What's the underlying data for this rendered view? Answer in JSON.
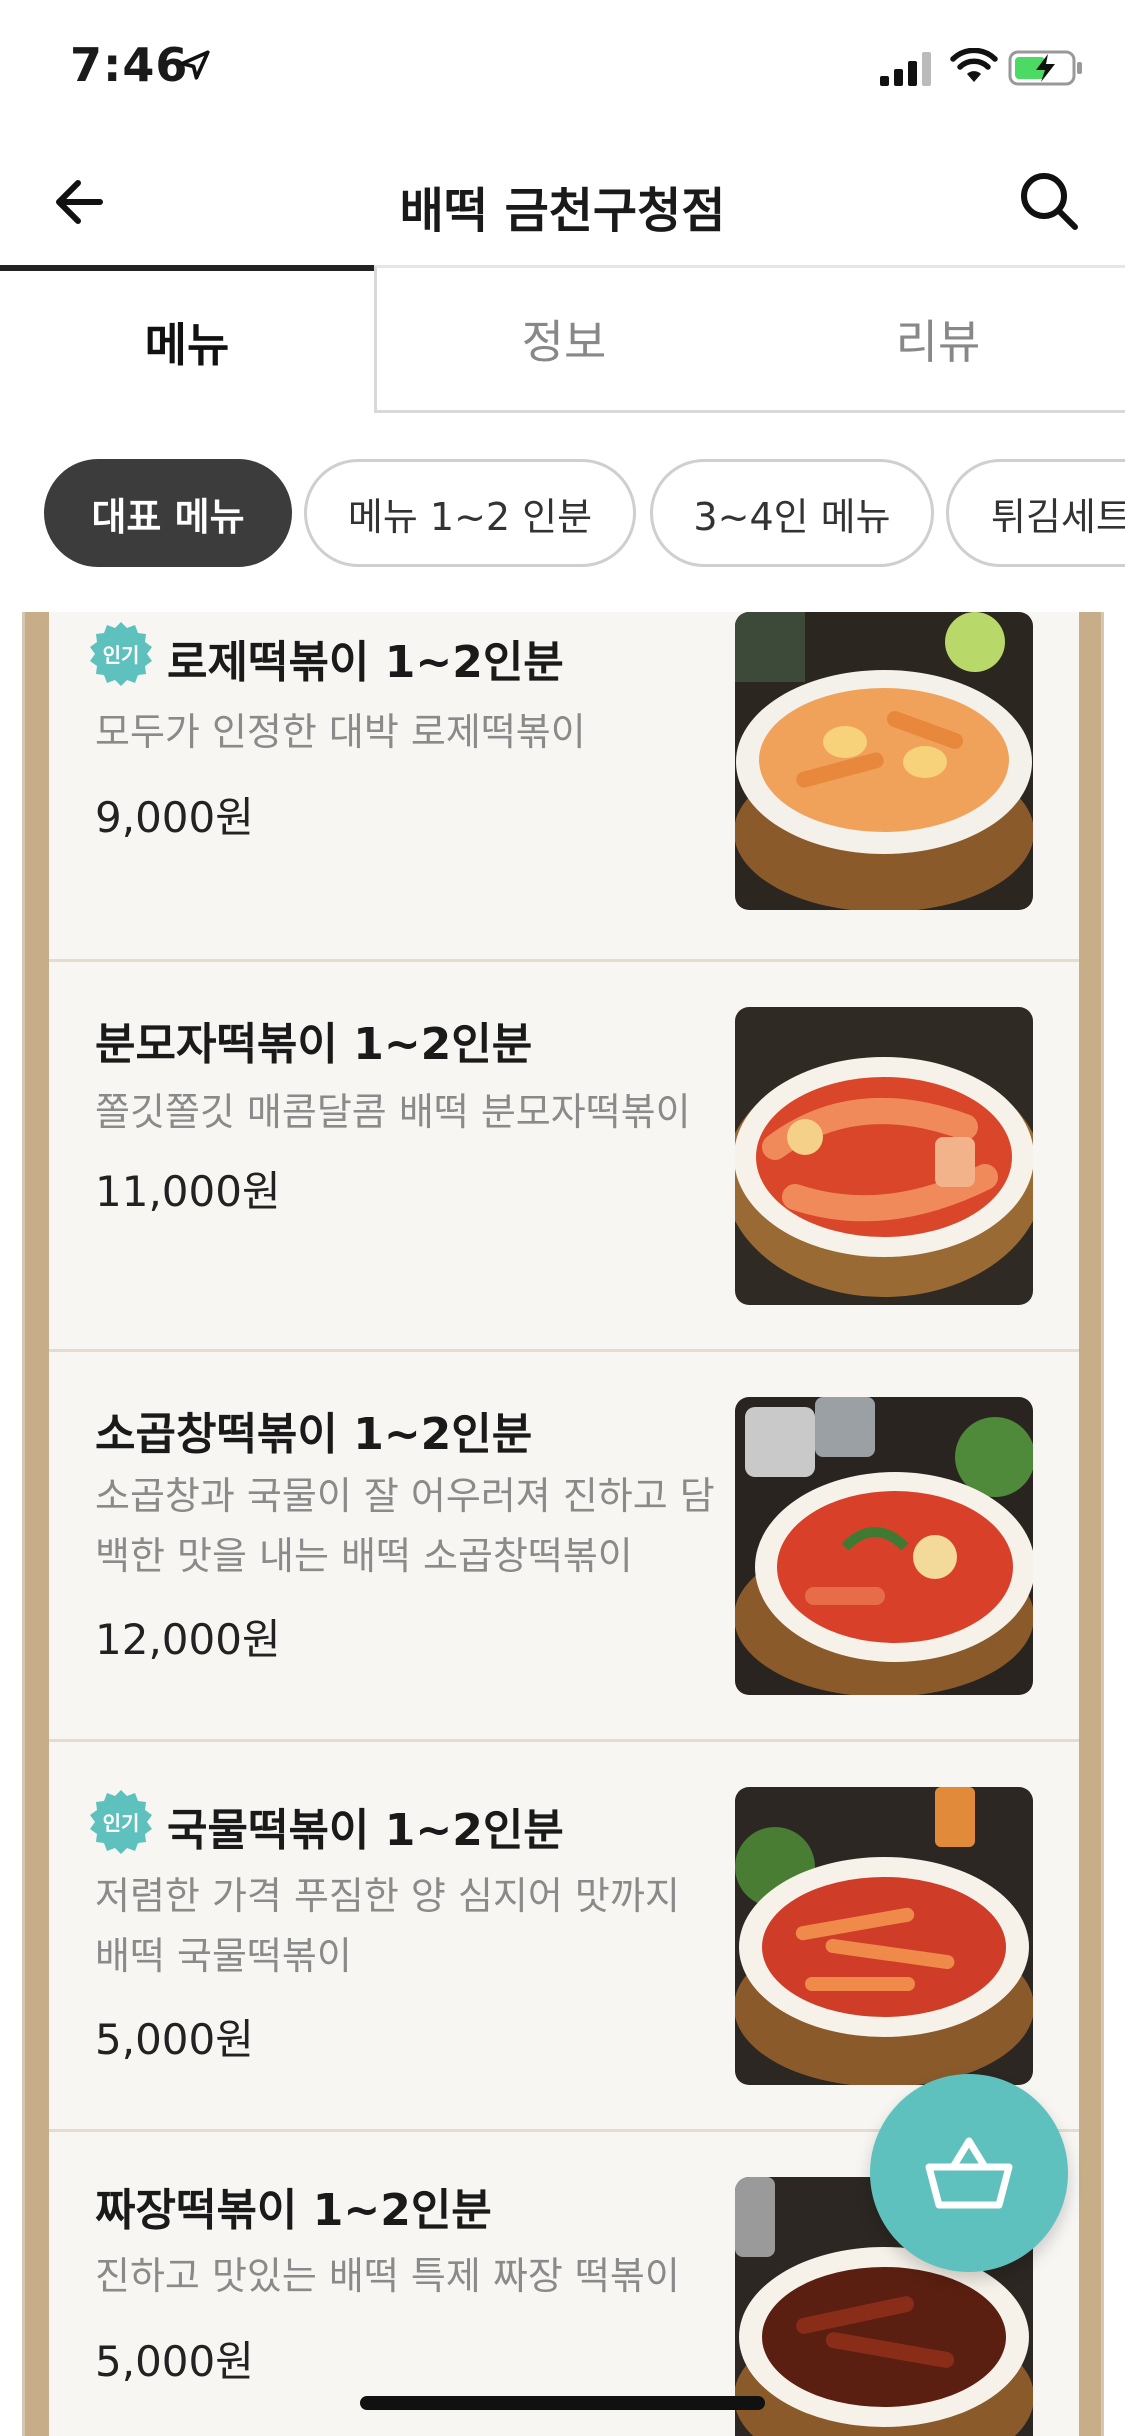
{
  "status_bar": {
    "time": "7:46"
  },
  "header": {
    "title": "배떡 금천구청점"
  },
  "tabs": [
    {
      "label": "메뉴"
    },
    {
      "label": "정보"
    },
    {
      "label": "리뷰"
    }
  ],
  "chips": [
    {
      "label": "대표 메뉴"
    },
    {
      "label": "메뉴  1~2 인분"
    },
    {
      "label": "3~4인 메뉴"
    },
    {
      "label": "튀김세트"
    }
  ],
  "badge_text": "인기",
  "menu_items": [
    {
      "name": "로제떡볶이 1~2인분",
      "description": "모두가 인정한 대박 로제떡볶이",
      "price": "9,000원",
      "popular": true
    },
    {
      "name": "분모자떡볶이 1~2인분",
      "description": "쫄깃쫄깃 매콤달콤 배떡 분모자떡볶이",
      "price": "11,000원",
      "popular": false
    },
    {
      "name": "소곱창떡볶이 1~2인분",
      "description": "소곱창과 국물이 잘 어우러져 진하고 담백한 맛을 내는 배떡 소곱창떡볶이",
      "price": "12,000원",
      "popular": false
    },
    {
      "name": "국물떡볶이 1~2인분",
      "description": "저렴한 가격 푸짐한 양 심지어 맛까지 배떡 국물떡볶이",
      "price": "5,000원",
      "popular": true
    },
    {
      "name": "짜장떡볶이 1~2인분",
      "description": "진하고 맛있는 배떡 특제 짜장 떡볶이",
      "price": "5,000원",
      "popular": false
    }
  ],
  "colors": {
    "accent": "#5fc1bd",
    "chip_active": "#3c3c3c",
    "panel_border": "#c8ae88"
  }
}
